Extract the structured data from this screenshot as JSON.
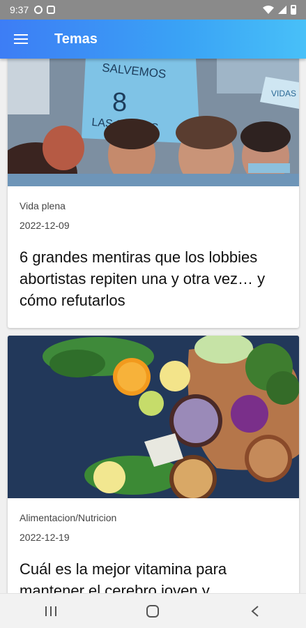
{
  "status_bar": {
    "time": "9:37"
  },
  "app_bar": {
    "title": "Temas"
  },
  "cards": [
    {
      "image_sign_text": "SALVEMOS LAS 2 VIDAS",
      "category": "Vida plena",
      "date": "2022-12-09",
      "title": "6 grandes mentiras que los lobbies abortistas repiten una y otra vez… y cómo refutarlos"
    },
    {
      "category": "Alimentacion/Nutricion",
      "date": "2022-12-19",
      "title": "Cuál es la mejor vitamina para mantener el cerebro joven y"
    }
  ],
  "nav_bar": {
    "buttons": [
      "recent-apps",
      "home",
      "back"
    ]
  },
  "colors": {
    "app_bar_start": "#3d7df5",
    "app_bar_end": "#48c0f8",
    "status_bar": "#8a8a8a"
  }
}
